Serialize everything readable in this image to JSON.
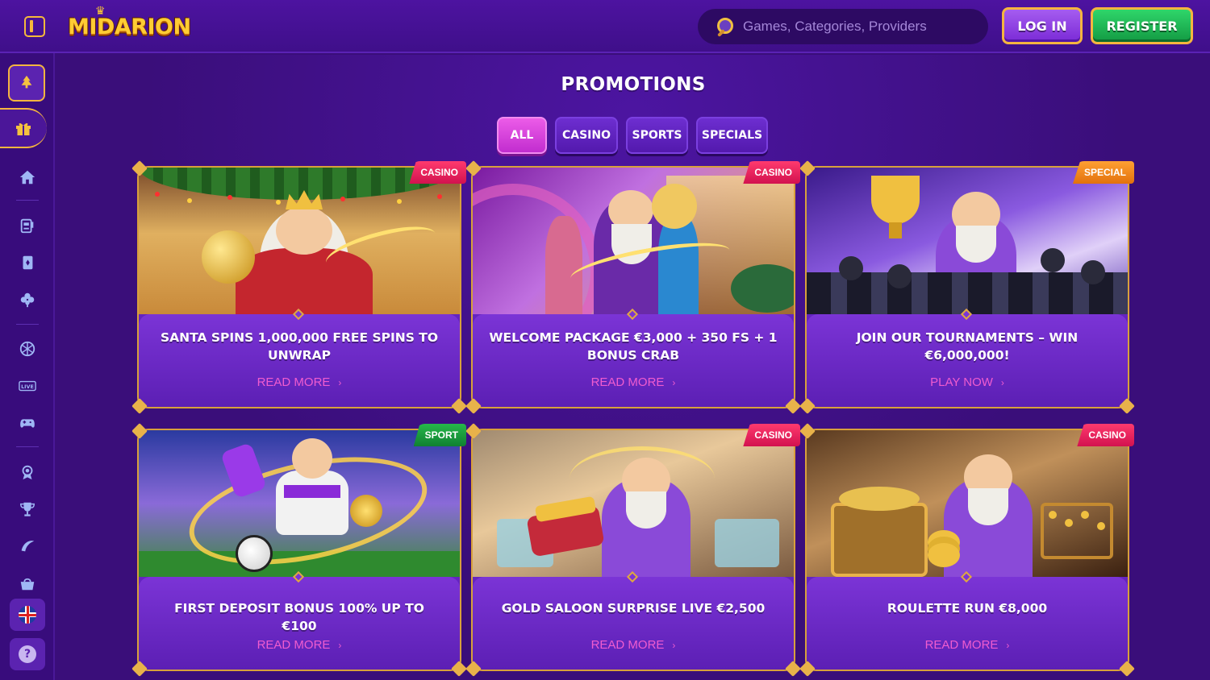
{
  "header": {
    "logo_text": "MIDARION",
    "search_placeholder": "Games, Categories, Providers",
    "login_label": "LOG IN",
    "register_label": "REGISTER"
  },
  "sidebar": {
    "items": [
      {
        "name": "christmas-tree",
        "icon": "tree-icon"
      },
      {
        "name": "promotions",
        "icon": "gift-icon"
      },
      {
        "name": "home",
        "icon": "home-icon"
      },
      {
        "name": "slots",
        "icon": "slot-machine-icon"
      },
      {
        "name": "card-games",
        "icon": "cards-icon"
      },
      {
        "name": "clover",
        "icon": "clover-icon"
      },
      {
        "name": "sports",
        "icon": "ball-icon"
      },
      {
        "name": "live",
        "icon": "live-icon",
        "label": "LIVE"
      },
      {
        "name": "games",
        "icon": "gamepad-icon"
      },
      {
        "name": "vip",
        "icon": "badge-icon"
      },
      {
        "name": "tournaments",
        "icon": "trophy-icon"
      },
      {
        "name": "wheel",
        "icon": "banana-icon"
      },
      {
        "name": "shop",
        "icon": "basket-icon"
      }
    ],
    "language": "EN",
    "help_label": "?"
  },
  "main": {
    "title": "PROMOTIONS",
    "tabs": [
      {
        "label": "ALL",
        "active": true
      },
      {
        "label": "CASINO",
        "active": false
      },
      {
        "label": "SPORTS",
        "active": false
      },
      {
        "label": "SPECIALS",
        "active": false
      }
    ],
    "promos": [
      {
        "badge": "CASINO",
        "title": "SANTA SPINS 1,000,000 FREE SPINS TO UNWRAP",
        "link": "READ MORE"
      },
      {
        "badge": "CASINO",
        "title": "WELCOME PACKAGE €3,000 + 350 FS + 1 BONUS CRAB",
        "link": "READ MORE"
      },
      {
        "badge": "SPECIAL",
        "title": "JOIN OUR TOURNAMENTS – WIN €6,000,000!",
        "link": "PLAY NOW"
      },
      {
        "badge": "SPORT",
        "title": "FIRST DEPOSIT BONUS 100% UP TO €100",
        "link": "READ MORE"
      },
      {
        "badge": "CASINO",
        "title": "GOLD SALOON SURPRISE LIVE €2,500",
        "link": "READ MORE"
      },
      {
        "badge": "CASINO",
        "title": "ROULETTE RUN €8,000",
        "link": "READ MORE"
      }
    ]
  },
  "colors": {
    "accent_gold": "#f5b53f",
    "link_pink": "#f05ccf",
    "bg_purple": "#3a0e7a",
    "register_green": "#1fbf56",
    "badge_casino": "#e81f5c",
    "badge_special": "#f08a22",
    "badge_sport": "#1a9a3c"
  }
}
